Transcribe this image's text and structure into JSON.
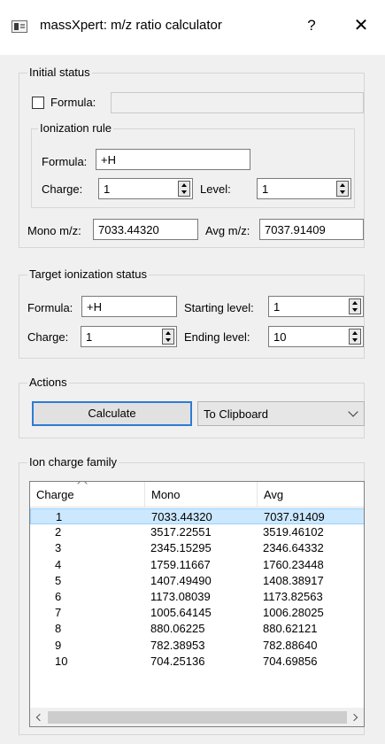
{
  "window": {
    "title": "massXpert: m/z ratio calculator",
    "help_label": "?",
    "close_label": "✕",
    "icon": "app-window-icon"
  },
  "initial_status": {
    "title": "Initial status",
    "formula_checkbox_label": "Formula:",
    "formula_checked": false,
    "formula_value": "",
    "ionization_rule": {
      "title": "Ionization rule",
      "formula_label": "Formula:",
      "formula_value": "+H",
      "charge_label": "Charge:",
      "charge_value": "1",
      "level_label": "Level:",
      "level_value": "1"
    },
    "mono_label": "Mono m/z:",
    "mono_value": "7033.44320",
    "avg_label": "Avg m/z:",
    "avg_value": "7037.91409"
  },
  "target_status": {
    "title": "Target ionization status",
    "formula_label": "Formula:",
    "formula_value": "+H",
    "starting_level_label": "Starting level:",
    "starting_level_value": "1",
    "charge_label": "Charge:",
    "charge_value": "1",
    "ending_level_label": "Ending level:",
    "ending_level_value": "10"
  },
  "actions": {
    "title": "Actions",
    "calculate_label": "Calculate",
    "target_selected": "To Clipboard"
  },
  "ion_family": {
    "title": "Ion charge family",
    "columns": [
      "Charge",
      "Mono",
      "Avg"
    ],
    "rows": [
      [
        "1",
        "7033.44320",
        "7037.91409"
      ],
      [
        "2",
        "3517.22551",
        "3519.46102"
      ],
      [
        "3",
        "2345.15295",
        "2346.64332"
      ],
      [
        "4",
        "1759.11667",
        "1760.23448"
      ],
      [
        "5",
        "1407.49490",
        "1408.38917"
      ],
      [
        "6",
        "1173.08039",
        "1173.82563"
      ],
      [
        "7",
        "1005.64145",
        "1006.28025"
      ],
      [
        "8",
        "880.06225",
        "880.62121"
      ],
      [
        "9",
        "782.38953",
        "782.88640"
      ],
      [
        "10",
        "704.25136",
        "704.69856"
      ]
    ],
    "selected_row": 0
  },
  "colors": {
    "selection": "#cce8ff",
    "focus_border": "#2e7bd3",
    "window_bg": "#f0f0f0"
  }
}
